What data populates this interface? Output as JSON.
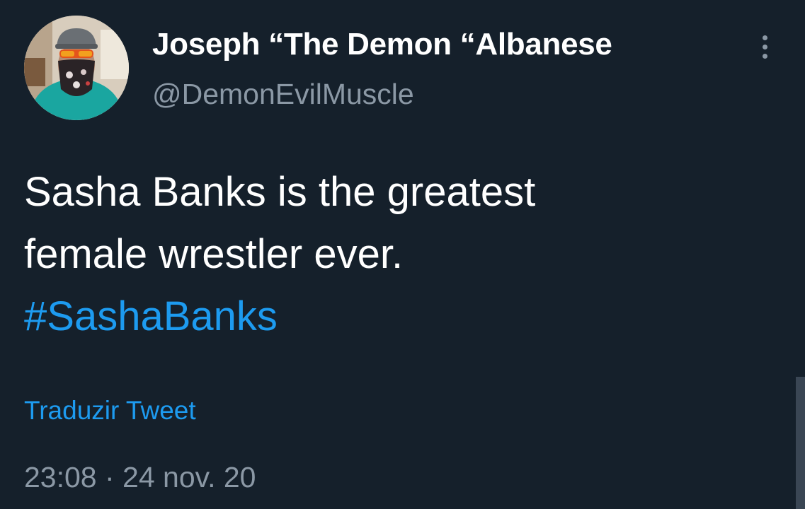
{
  "author": {
    "name": "Joseph “The Demon “Albanese",
    "handle": "@DemonEvilMuscle"
  },
  "tweet": {
    "text_line_1": "Sasha Banks is the greatest",
    "text_line_2": "female wrestler ever.",
    "hashtag": "#SashaBanks",
    "translate_label": "Traduzir Tweet",
    "timestamp": "23:08 · 24 nov. 20"
  },
  "icons": {
    "more": "more-vertical-icon"
  },
  "colors": {
    "background": "#15202b",
    "primary_text": "#ffffff",
    "secondary_text": "#8b98a5",
    "link": "#1d9bf0"
  }
}
